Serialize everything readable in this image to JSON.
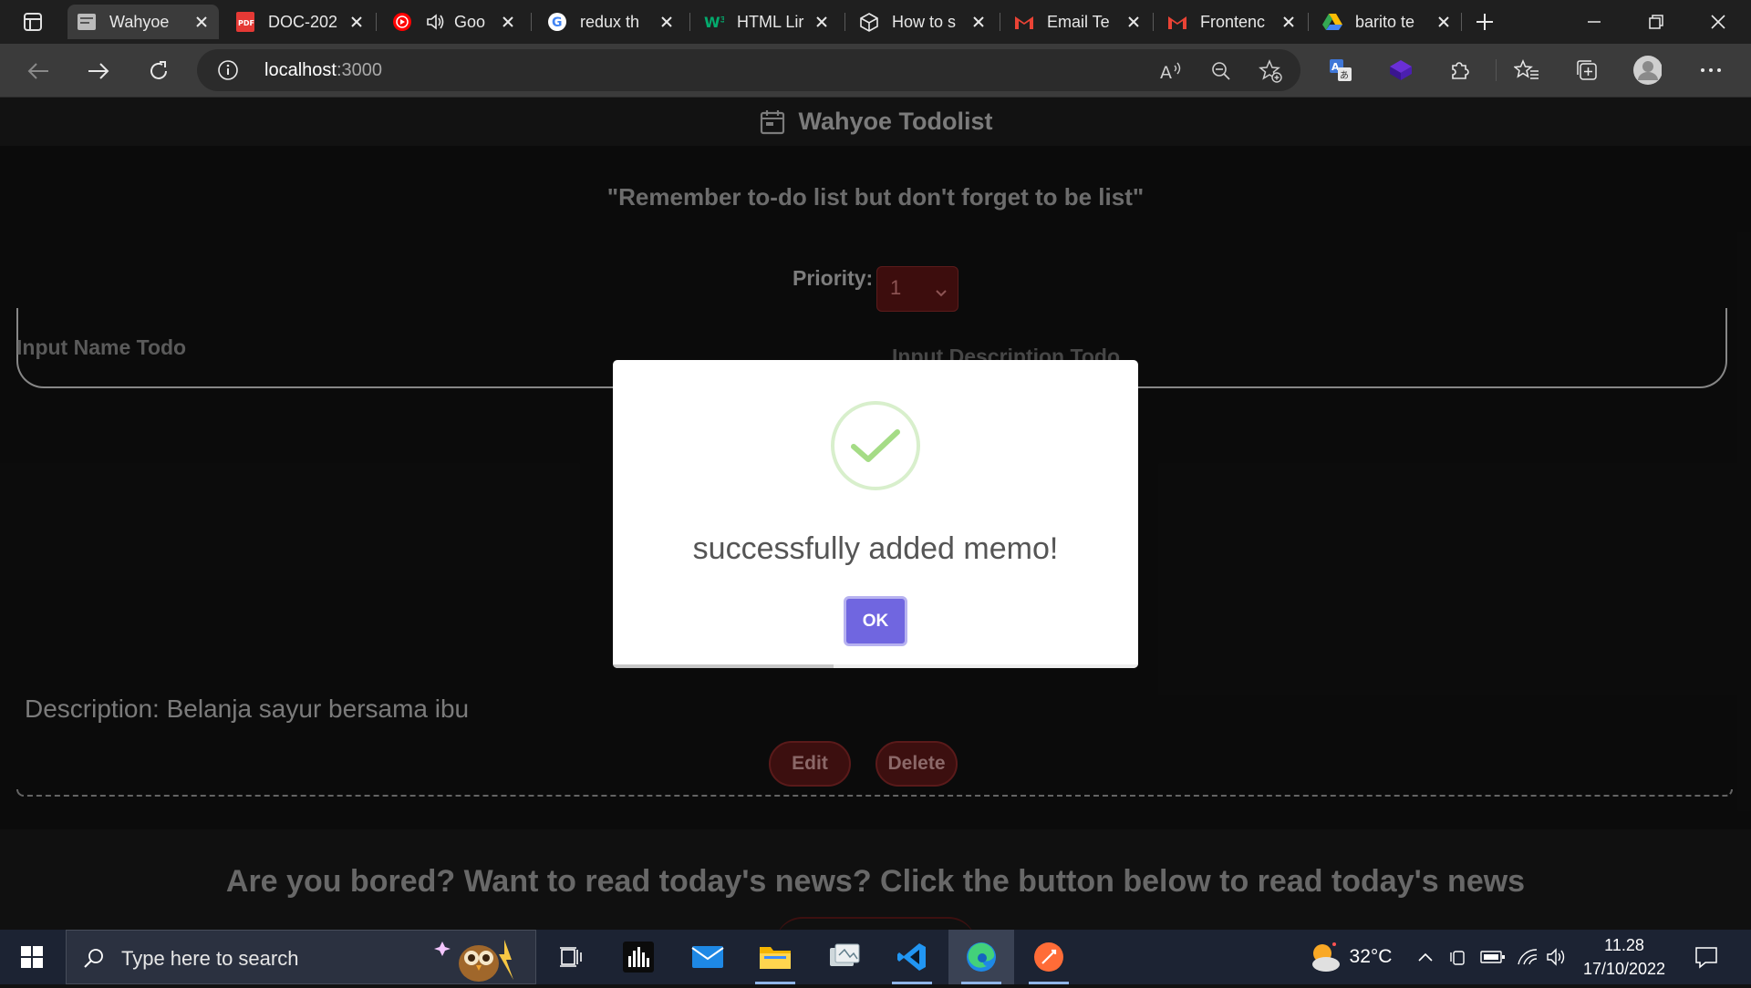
{
  "browser": {
    "tabs": [
      {
        "title": "Wahyoe",
        "favicon": "site-favicon",
        "active": true
      },
      {
        "title": "DOC-202",
        "favicon": "pdf-icon"
      },
      {
        "title": "Goo",
        "favicon": "youtube-music-icon",
        "audio": true
      },
      {
        "title": "redux th",
        "favicon": "google-icon"
      },
      {
        "title": "HTML Lir",
        "favicon": "w3-icon"
      },
      {
        "title": "How to s",
        "favicon": "codesandbox-icon"
      },
      {
        "title": "Email Te",
        "favicon": "gmail-icon"
      },
      {
        "title": "Frontenc",
        "favicon": "gmail-icon"
      },
      {
        "title": "barito te",
        "favicon": "google-drive-icon"
      }
    ],
    "address": {
      "host": "localhost",
      "port": ":3000"
    }
  },
  "page": {
    "app_title": "Wahyoe Todolist",
    "quote": "\"Remember to-do list but don't forget to be list\"",
    "priority_label": "Priority:",
    "priority_value": "1",
    "name_placeholder": "Input Name Todo",
    "desc_placeholder": "Input Description Todo",
    "todo_description": "Description: Belanja sayur bersama ibu",
    "edit_label": "Edit",
    "delete_label": "Delete",
    "news_text": "Are you bored? Want to read today's news? Click the button below to read today's news"
  },
  "modal": {
    "message": "successfully added memo!",
    "ok_label": "OK",
    "timer_progress": 0.42
  },
  "taskbar": {
    "search_placeholder": "Type here to search",
    "weather": "32°C",
    "time": "11.28",
    "date": "17/10/2022"
  },
  "colors": {
    "accent_ok": "#7066e0",
    "success_check": "#a5dc86",
    "danger": "#5c1717"
  }
}
